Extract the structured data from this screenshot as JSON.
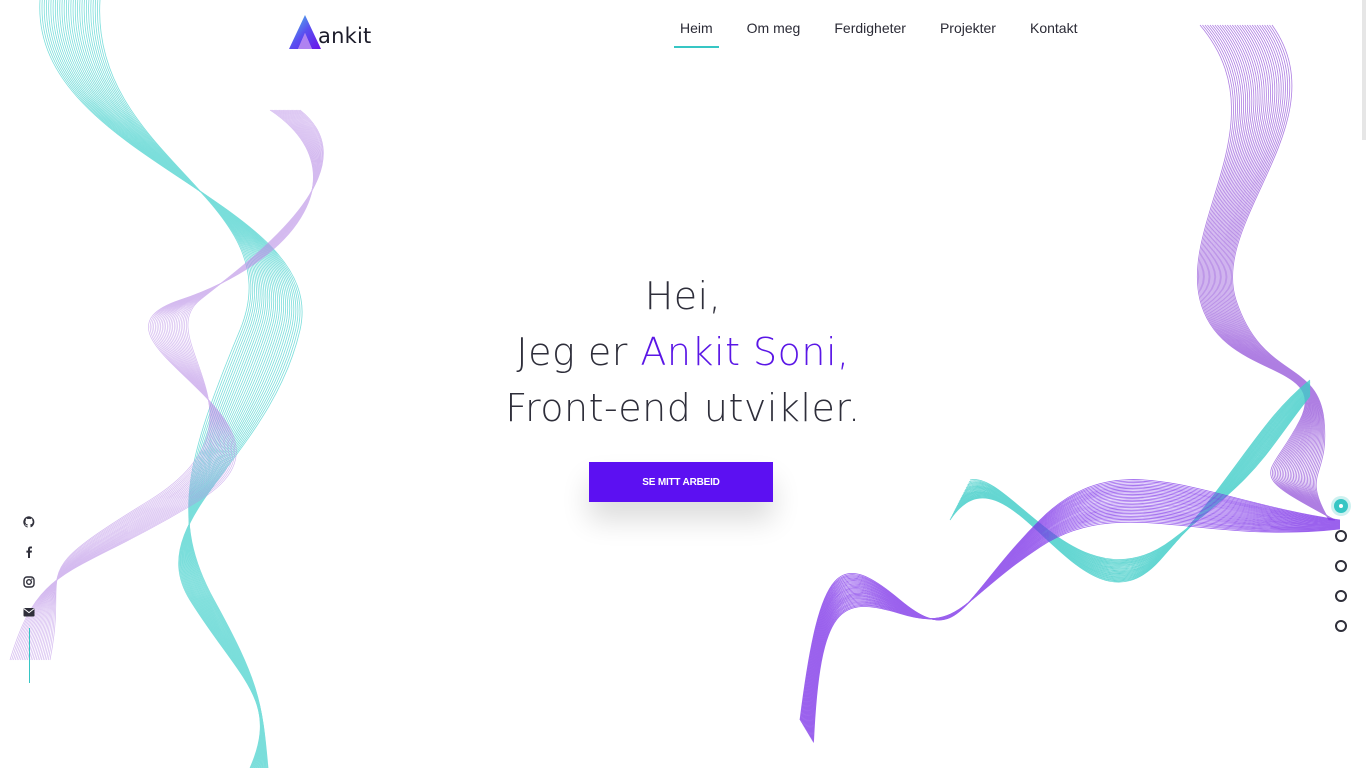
{
  "brand": {
    "name": "ankit",
    "mark_icon": "ankit-logo-icon"
  },
  "nav": {
    "items": [
      {
        "label": "Heim",
        "active": true
      },
      {
        "label": "Om meg",
        "active": false
      },
      {
        "label": "Ferdigheter",
        "active": false
      },
      {
        "label": "Projekter",
        "active": false
      },
      {
        "label": "Kontakt",
        "active": false
      }
    ]
  },
  "hero": {
    "greeting": "Hei,",
    "intro_prefix": "Jeg er ",
    "name": "Ankit Soni,",
    "role": "Front-end utvikler.",
    "cta_label": "SE MITT ARBEID"
  },
  "social": {
    "icons": [
      "github-icon",
      "facebook-icon",
      "instagram-icon",
      "envelope-icon"
    ]
  },
  "section_dots": {
    "count": 5,
    "active_index": 0
  },
  "colors": {
    "accent": "#5a16e6",
    "button": "#5c10f2",
    "teal": "#36c6c4",
    "purple_wave": "#8a4fd8",
    "text": "#2e2e3a"
  }
}
